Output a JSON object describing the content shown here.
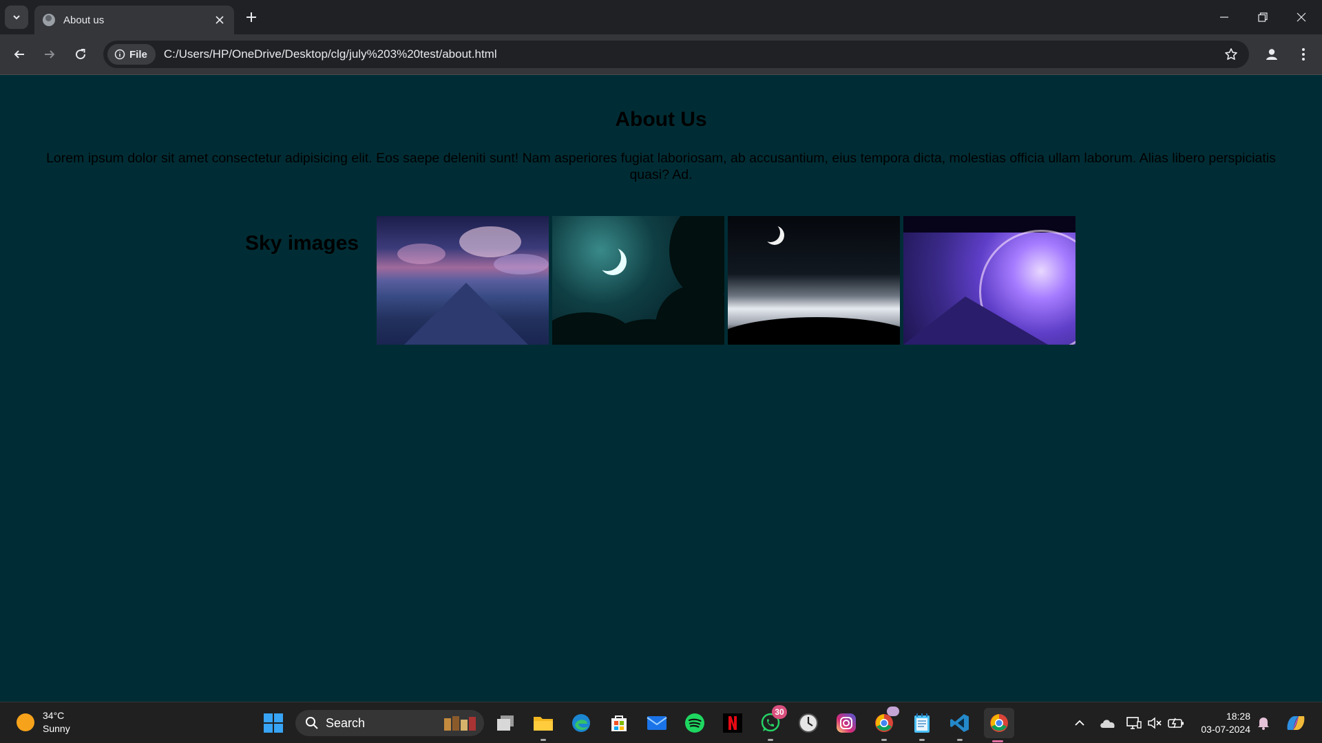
{
  "browser": {
    "tab_title": "About us",
    "site_chip": "File",
    "url": "C:/Users/HP/OneDrive/Desktop/clg/july%203%20test/about.html"
  },
  "page": {
    "title": "About Us",
    "paragraph": "Lorem ipsum dolor sit amet consectetur adipisicing elit. Eos saepe deleniti sunt! Nam asperiores fugiat laboriosam, ab accusantium, eius tempora dicta, molestias officia ullam laborum. Alias libero perspiciatis quasi? Ad.",
    "gallery_heading": "Sky images",
    "images": [
      {
        "name": "sky-image-clouds-road"
      },
      {
        "name": "sky-image-crescent-moon-trees"
      },
      {
        "name": "sky-image-moon-clouds"
      },
      {
        "name": "sky-image-purple-planet"
      }
    ]
  },
  "taskbar": {
    "weather_temp": "34°C",
    "weather_desc": "Sunny",
    "search_placeholder": "Search",
    "whatsapp_badge": "30",
    "time": "18:28",
    "date": "03-07-2024",
    "colors": {
      "accent": "#37a4f5",
      "page_background": "#002d35",
      "badge": "#d9507d"
    }
  }
}
